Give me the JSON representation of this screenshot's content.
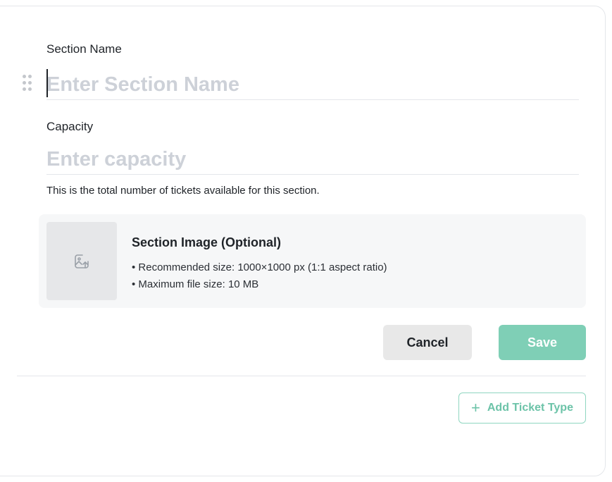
{
  "section_name": {
    "label": "Section Name",
    "value": "",
    "placeholder": "Enter Section Name"
  },
  "capacity": {
    "label": "Capacity",
    "value": "",
    "placeholder": "Enter capacity",
    "help": "This is the total number of tickets available for this section."
  },
  "section_image": {
    "title": "Section Image (Optional)",
    "bullets": [
      "• Recommended size: 1000×1000 px (1:1 aspect ratio)",
      "• Maximum file size: 10 MB"
    ],
    "icon": "image-upload-icon"
  },
  "actions": {
    "cancel_label": "Cancel",
    "save_label": "Save"
  },
  "add_ticket": {
    "label": "Add Ticket Type",
    "icon": "plus-icon"
  },
  "colors": {
    "accent": "#7fcfb6",
    "accent_text": "#6cc3a8",
    "placeholder": "#cdd1d8",
    "panel_bg": "#f6f7f8"
  }
}
